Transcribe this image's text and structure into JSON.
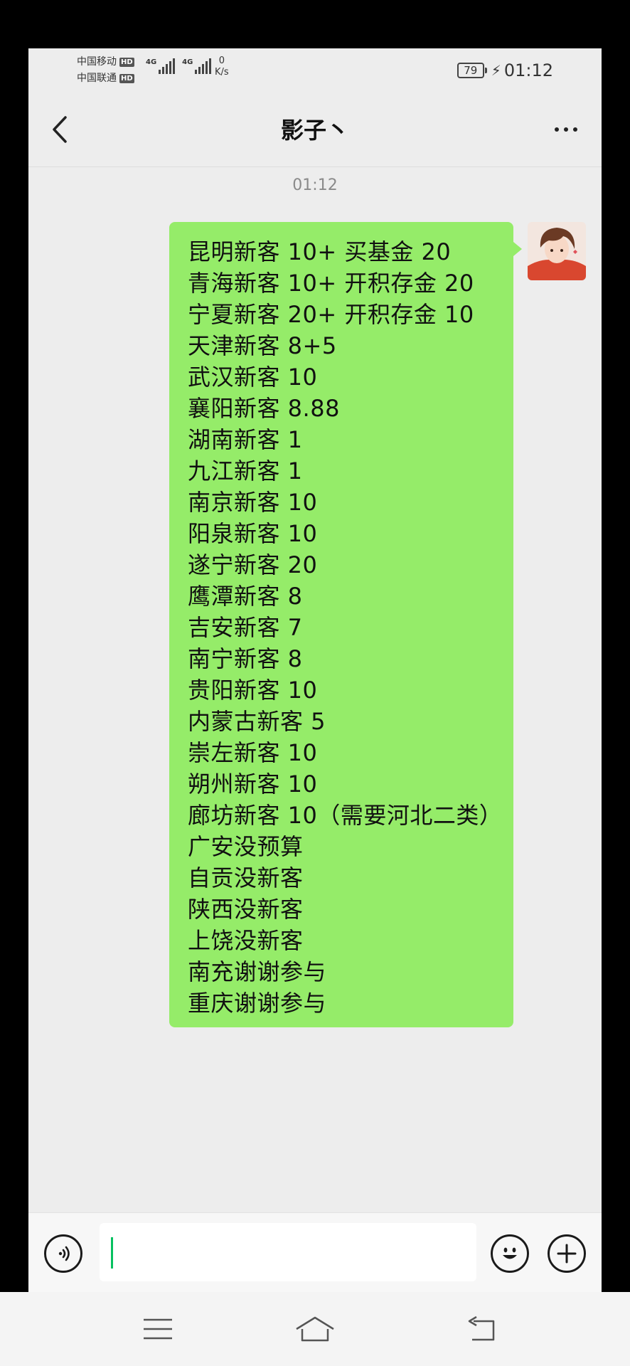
{
  "status_bar": {
    "carrier_1": "中国移动",
    "carrier_2": "中国联通",
    "hd_label": "HD",
    "signal_label_1": "4G",
    "signal_label_2": "4G",
    "net_speed_value": "0",
    "net_speed_unit": "K/s",
    "battery": "79",
    "time": "01:12"
  },
  "header": {
    "title": "影子丶"
  },
  "chat": {
    "timestamp": "01:12",
    "message_lines": [
      "昆明新客 10+ 买基金 20",
      "青海新客 10+ 开积存金 20",
      "宁夏新客 20+ 开积存金 10",
      "天津新客 8+5",
      "武汉新客 10",
      "襄阳新客 8.88",
      "湖南新客 1",
      "九江新客 1",
      "南京新客 10",
      "阳泉新客 10",
      "遂宁新客 20",
      "鹰潭新客 8",
      "吉安新客 7",
      "南宁新客 8",
      "贵阳新客 10",
      "内蒙古新客 5",
      "崇左新客 10",
      "朔州新客 10",
      "廊坊新客 10（需要河北二类）",
      "广安没预算",
      "自贡没新客",
      "陕西没新客",
      "上饶没新客",
      "南充谢谢参与",
      "重庆谢谢参与"
    ]
  },
  "colors": {
    "bubble": "#95ec69",
    "background": "#ededed",
    "caret": "#07c160"
  },
  "icons": {
    "back": "chevron-left-icon",
    "more": "more-dots-icon",
    "voice": "voice-icon",
    "emoji": "emoji-icon",
    "plus": "plus-icon",
    "nav_menu": "menu-icon",
    "nav_home": "home-icon",
    "nav_back": "back-icon"
  }
}
